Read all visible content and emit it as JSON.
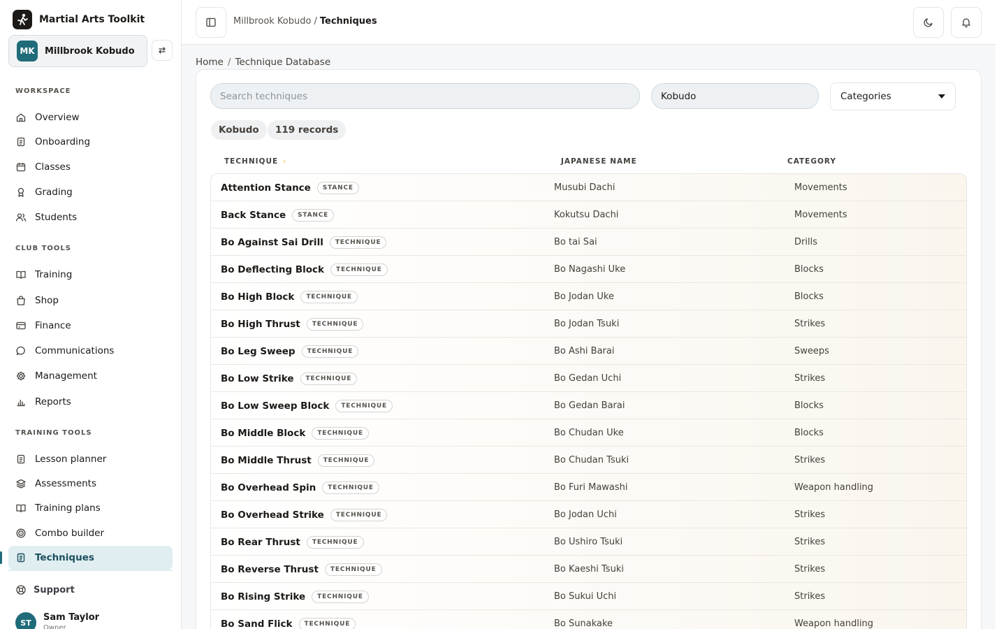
{
  "app": {
    "title": "Martial Arts Toolkit"
  },
  "club": {
    "initials": "MK",
    "name": "Millbrook Kobudo"
  },
  "sidebar": {
    "workspace_label": "WORKSPACE",
    "club_tools_label": "CLUB TOOLS",
    "training_tools_label": "TRAINING TOOLS",
    "workspace": [
      {
        "label": "Overview",
        "icon": "home-icon"
      },
      {
        "label": "Onboarding",
        "icon": "clipboard-icon"
      },
      {
        "label": "Classes",
        "icon": "calendar-icon"
      },
      {
        "label": "Grading",
        "icon": "award-icon"
      },
      {
        "label": "Students",
        "icon": "users-icon"
      }
    ],
    "club_tools": [
      {
        "label": "Training",
        "icon": "book-open-icon"
      },
      {
        "label": "Shop",
        "icon": "shopping-bag-icon"
      },
      {
        "label": "Finance",
        "icon": "credit-card-icon"
      },
      {
        "label": "Communications",
        "icon": "chat-bubble-icon"
      },
      {
        "label": "Management",
        "icon": "gear-icon"
      },
      {
        "label": "Reports",
        "icon": "bar-chart-icon"
      }
    ],
    "training_tools": [
      {
        "label": "Lesson planner",
        "icon": "clipboard-icon"
      },
      {
        "label": "Assessments",
        "icon": "layers-icon"
      },
      {
        "label": "Training plans",
        "icon": "book-open-icon"
      },
      {
        "label": "Combo builder",
        "icon": "target-icon"
      },
      {
        "label": "Techniques",
        "icon": "document-icon",
        "active": true
      }
    ],
    "support": "Support",
    "user": {
      "initials": "ST",
      "name": "Sam Taylor",
      "role": "Owner"
    }
  },
  "topbar": {
    "breadcrumb_parent": "Millbrook Kobudo",
    "breadcrumb_sep": "/",
    "breadcrumb_current": "Techniques"
  },
  "page": {
    "breadcrumb_home": "Home",
    "breadcrumb_sep": "/",
    "breadcrumb_current": "Technique Database"
  },
  "filters": {
    "search_placeholder": "Search techniques",
    "style_value": "Kobudo",
    "category_select": "Categories"
  },
  "chips": {
    "style": "Kobudo",
    "count": "119 records"
  },
  "table": {
    "headers": {
      "technique": "TECHNIQUE",
      "japanese": "JAPANESE NAME",
      "category": "CATEGORY"
    },
    "rows": [
      {
        "name": "Attention Stance",
        "type": "STANCE",
        "japanese": "Musubi Dachi",
        "category": "Movements"
      },
      {
        "name": "Back Stance",
        "type": "STANCE",
        "japanese": "Kokutsu Dachi",
        "category": "Movements"
      },
      {
        "name": "Bo Against Sai Drill",
        "type": "TECHNIQUE",
        "japanese": "Bo tai Sai",
        "category": "Drills"
      },
      {
        "name": "Bo Deflecting Block",
        "type": "TECHNIQUE",
        "japanese": "Bo Nagashi Uke",
        "category": "Blocks"
      },
      {
        "name": "Bo High Block",
        "type": "TECHNIQUE",
        "japanese": "Bo Jodan Uke",
        "category": "Blocks"
      },
      {
        "name": "Bo High Thrust",
        "type": "TECHNIQUE",
        "japanese": "Bo Jodan Tsuki",
        "category": "Strikes"
      },
      {
        "name": "Bo Leg Sweep",
        "type": "TECHNIQUE",
        "japanese": "Bo Ashi Barai",
        "category": "Sweeps"
      },
      {
        "name": "Bo Low Strike",
        "type": "TECHNIQUE",
        "japanese": "Bo Gedan Uchi",
        "category": "Strikes"
      },
      {
        "name": "Bo Low Sweep Block",
        "type": "TECHNIQUE",
        "japanese": "Bo Gedan Barai",
        "category": "Blocks"
      },
      {
        "name": "Bo Middle Block",
        "type": "TECHNIQUE",
        "japanese": "Bo Chudan Uke",
        "category": "Blocks"
      },
      {
        "name": "Bo Middle Thrust",
        "type": "TECHNIQUE",
        "japanese": "Bo Chudan Tsuki",
        "category": "Strikes"
      },
      {
        "name": "Bo Overhead Spin",
        "type": "TECHNIQUE",
        "japanese": "Bo Furi Mawashi",
        "category": "Weapon handling"
      },
      {
        "name": "Bo Overhead Strike",
        "type": "TECHNIQUE",
        "japanese": "Bo Jodan Uchi",
        "category": "Strikes"
      },
      {
        "name": "Bo Rear Thrust",
        "type": "TECHNIQUE",
        "japanese": "Bo Ushiro Tsuki",
        "category": "Strikes"
      },
      {
        "name": "Bo Reverse Thrust",
        "type": "TECHNIQUE",
        "japanese": "Bo Kaeshi Tsuki",
        "category": "Strikes"
      },
      {
        "name": "Bo Rising Strike",
        "type": "TECHNIQUE",
        "japanese": "Bo Sukui Uchi",
        "category": "Strikes"
      },
      {
        "name": "Bo Sand Flick",
        "type": "TECHNIQUE",
        "japanese": "Bo Sunakake",
        "category": "Weapon handling"
      }
    ]
  },
  "colors": {
    "accent": "#1f6b7a",
    "active_bg": "#e0eef2",
    "page_bg": "#f6f7f8"
  }
}
